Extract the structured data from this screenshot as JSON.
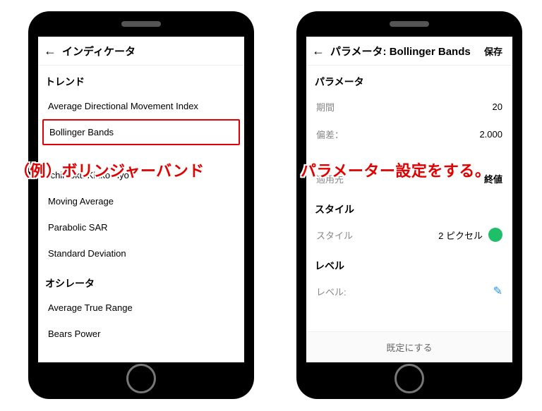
{
  "left": {
    "title": "インディケータ",
    "sections": {
      "trend": {
        "header": "トレンド",
        "items": [
          "Average Directional Movement Index",
          "Bollinger Bands",
          "",
          "Ichimoku Kinko Hyo",
          "Moving Average",
          "Parabolic SAR",
          "Standard Deviation"
        ]
      },
      "oscillator": {
        "header": "オシレータ",
        "items": [
          "Average True Range",
          "Bears Power"
        ]
      }
    },
    "annotation": "（例）ボリンジャーバンド"
  },
  "right": {
    "title": "パラメータ: Bollinger Bands",
    "save": "保存",
    "sections": {
      "param": {
        "header": "パラメータ",
        "rows": {
          "period": {
            "label": "期間",
            "value": "20"
          },
          "deviation": {
            "label": "偏差：",
            "value": "2.000"
          },
          "applyto": {
            "label": "適用先",
            "value": "終値"
          }
        }
      },
      "style": {
        "header": "スタイル",
        "row": {
          "label": "スタイル",
          "value": "2 ピクセル"
        }
      },
      "level": {
        "header": "レベル",
        "row": {
          "label": "レベル:"
        }
      }
    },
    "footer": "既定にする",
    "annotation": "パラメーター設定をする。"
  }
}
